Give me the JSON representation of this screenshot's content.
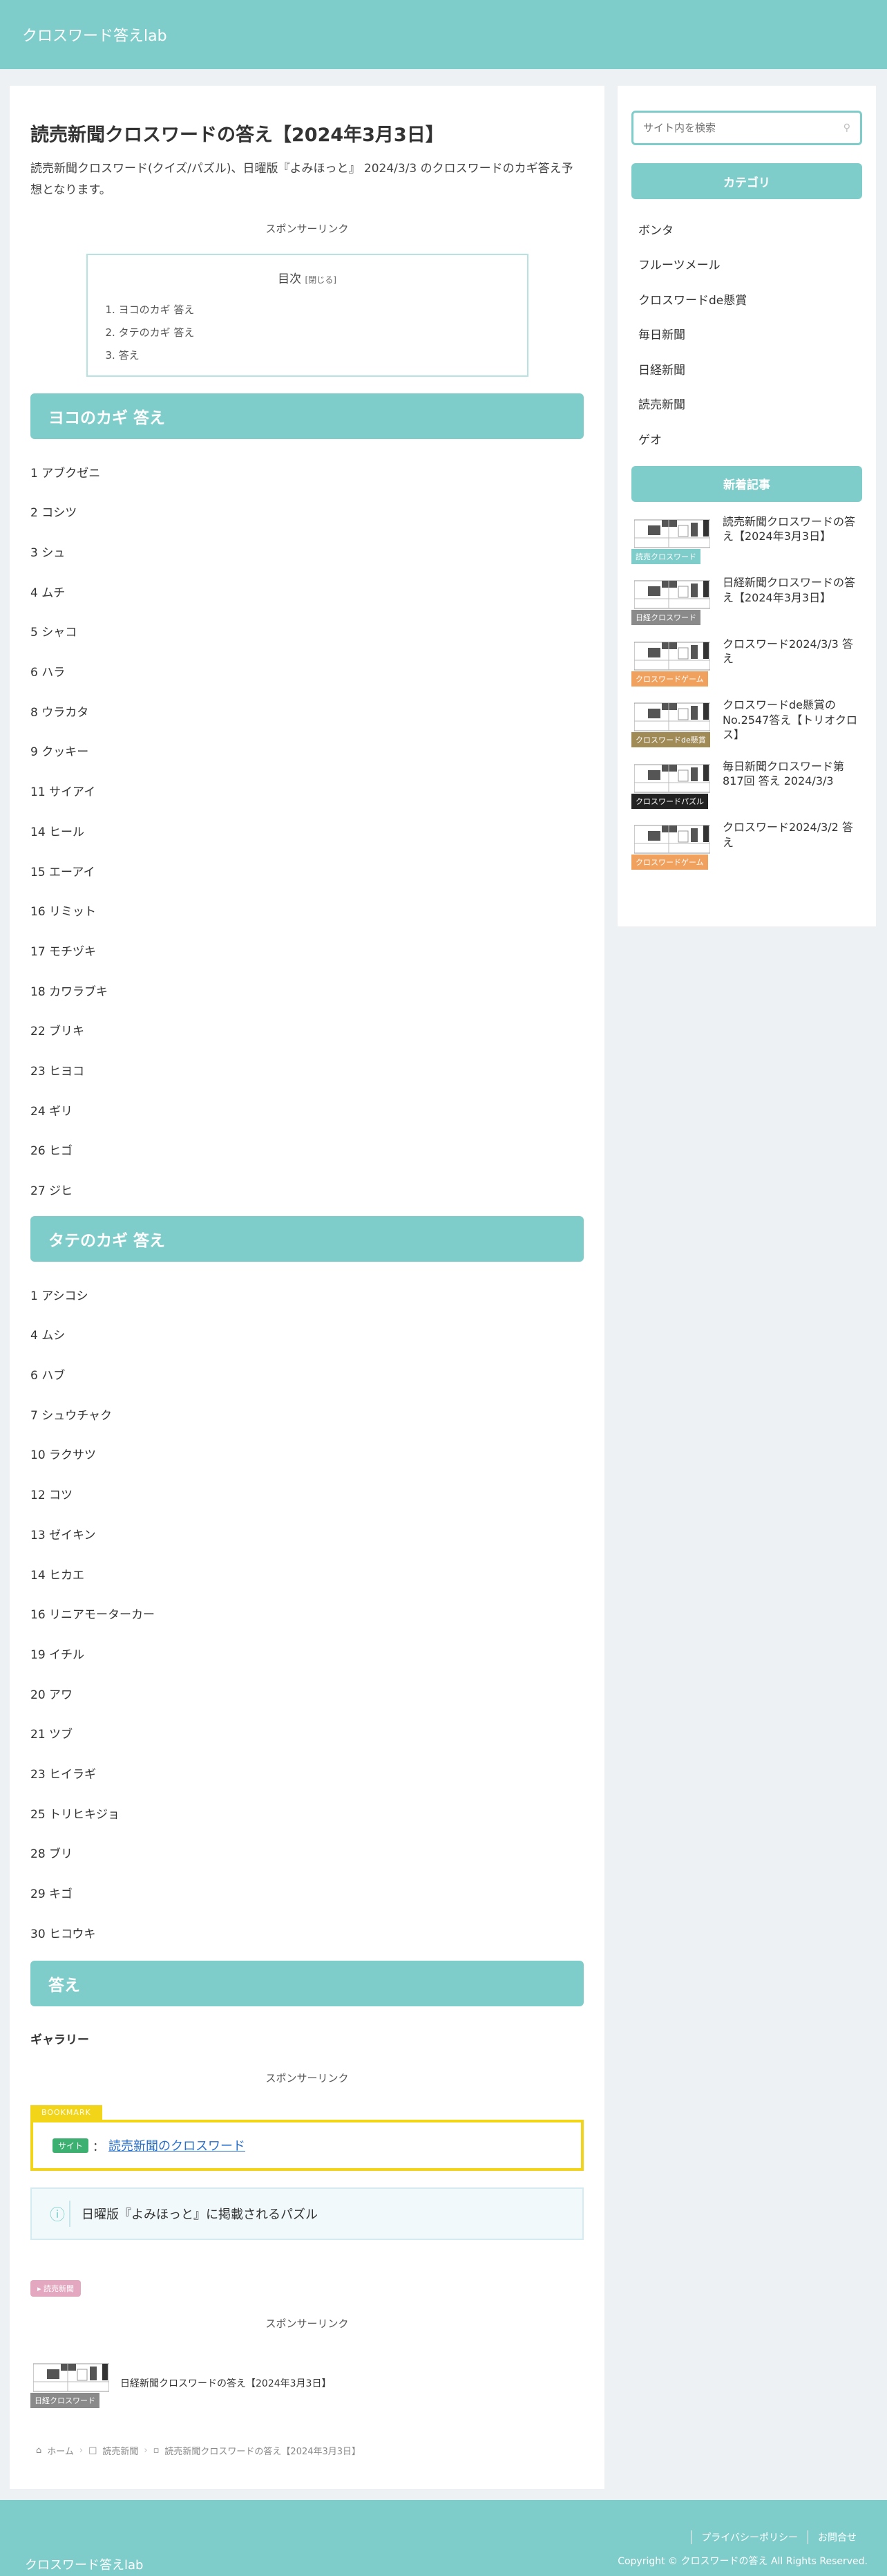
{
  "header": {
    "site_title": "クロスワード答えlab"
  },
  "post": {
    "title": "読売新聞クロスワードの答え【2024年3月3日】",
    "lead": "読売新聞クロスワード(クイズ/パズル)、日曜版『よみほっと』 2024/3/3 のクロスワードのカギ答え予想となります。",
    "sponsor_label": "スポンサーリンク",
    "toc": {
      "title": "目次",
      "toggle": "[閉じる]",
      "items": [
        "1. ヨコのカギ 答え",
        "2. タテのカギ 答え",
        "3. 答え"
      ]
    },
    "yoko_heading": "ヨコのカギ 答え",
    "yoko": [
      "1 アブクゼニ",
      "2 コシツ",
      "3 シュ",
      "4 ムチ",
      "5 シャコ",
      "6 ハラ",
      "8 ウラカタ",
      "9 クッキー",
      "11 サイアイ",
      "14 ヒール",
      "15 エーアイ",
      "16 リミット",
      "17 モチヅキ",
      "18 カワラブキ",
      "22 ブリキ",
      "23 ヒヨコ",
      "24 ギリ",
      "26 ヒゴ",
      "27 ジヒ"
    ],
    "tate_heading": "タテのカギ 答え",
    "tate": [
      "1 アシコシ",
      "4 ムシ",
      "6 ハブ",
      "7 シュウチャク",
      "10 ラクサツ",
      "12 コツ",
      "13 ゼイキン",
      "14 ヒカエ",
      "16 リニアモーターカー",
      "19 イチル",
      "20 アワ",
      "21 ツブ",
      "23 ヒイラギ",
      "25 トリヒキジョ",
      "28 ブリ",
      "29 キゴ",
      "30 ヒコウキ"
    ],
    "answer_heading": "答え",
    "gallery_label": "ギャラリー",
    "bookmark": {
      "tag": "BOOKMARK",
      "badge": "サイト",
      "separator": "：",
      "link": "読売新聞のクロスワード"
    },
    "info_text": "日曜版『よみほっと』に掲載されるパズル",
    "tag_chip": "読売新聞",
    "related": {
      "category": "日経クロスワード",
      "title": "日経新聞クロスワードの答え【2024年3月3日】"
    },
    "breadcrumb": [
      "ホーム",
      "読売新聞",
      "読売新聞クロスワードの答え【2024年3月3日】"
    ]
  },
  "sidebar": {
    "search_placeholder": "サイト内を検索",
    "category_heading": "カテゴリ",
    "categories": [
      "ボンタ",
      "フルーツメール",
      "クロスワードde懸賞",
      "毎日新聞",
      "日経新聞",
      "読売新聞",
      "ゲオ"
    ],
    "new_heading": "新着記事",
    "new_posts": [
      {
        "category": "読売クロスワード",
        "cat_color": "#7fcdca",
        "title": "読売新聞クロスワードの答え【2024年3月3日】"
      },
      {
        "category": "日経クロスワード",
        "cat_color": "#8a8a8a",
        "title": "日経新聞クロスワードの答え【2024年3月3日】"
      },
      {
        "category": "クロスワードゲーム",
        "cat_color": "#f0a15e",
        "title": "クロスワード2024/3/3 答え"
      },
      {
        "category": "クロスワードde懸賞",
        "cat_color": "#a08a55",
        "title": "クロスワードde懸賞のNo.2547答え【トリオクロス】"
      },
      {
        "category": "クロスワードパズル",
        "cat_color": "#222222",
        "title": "毎日新聞クロスワード第817回 答え 2024/3/3"
      },
      {
        "category": "クロスワードゲーム",
        "cat_color": "#f0a15e",
        "title": "クロスワード2024/3/2 答え"
      }
    ]
  },
  "footer": {
    "site_title": "クロスワード答えlab",
    "links": [
      "プライバシーポリシー",
      "お問合せ"
    ],
    "copyright": "Copyright © クロスワードの答え All Rights Reserved."
  }
}
